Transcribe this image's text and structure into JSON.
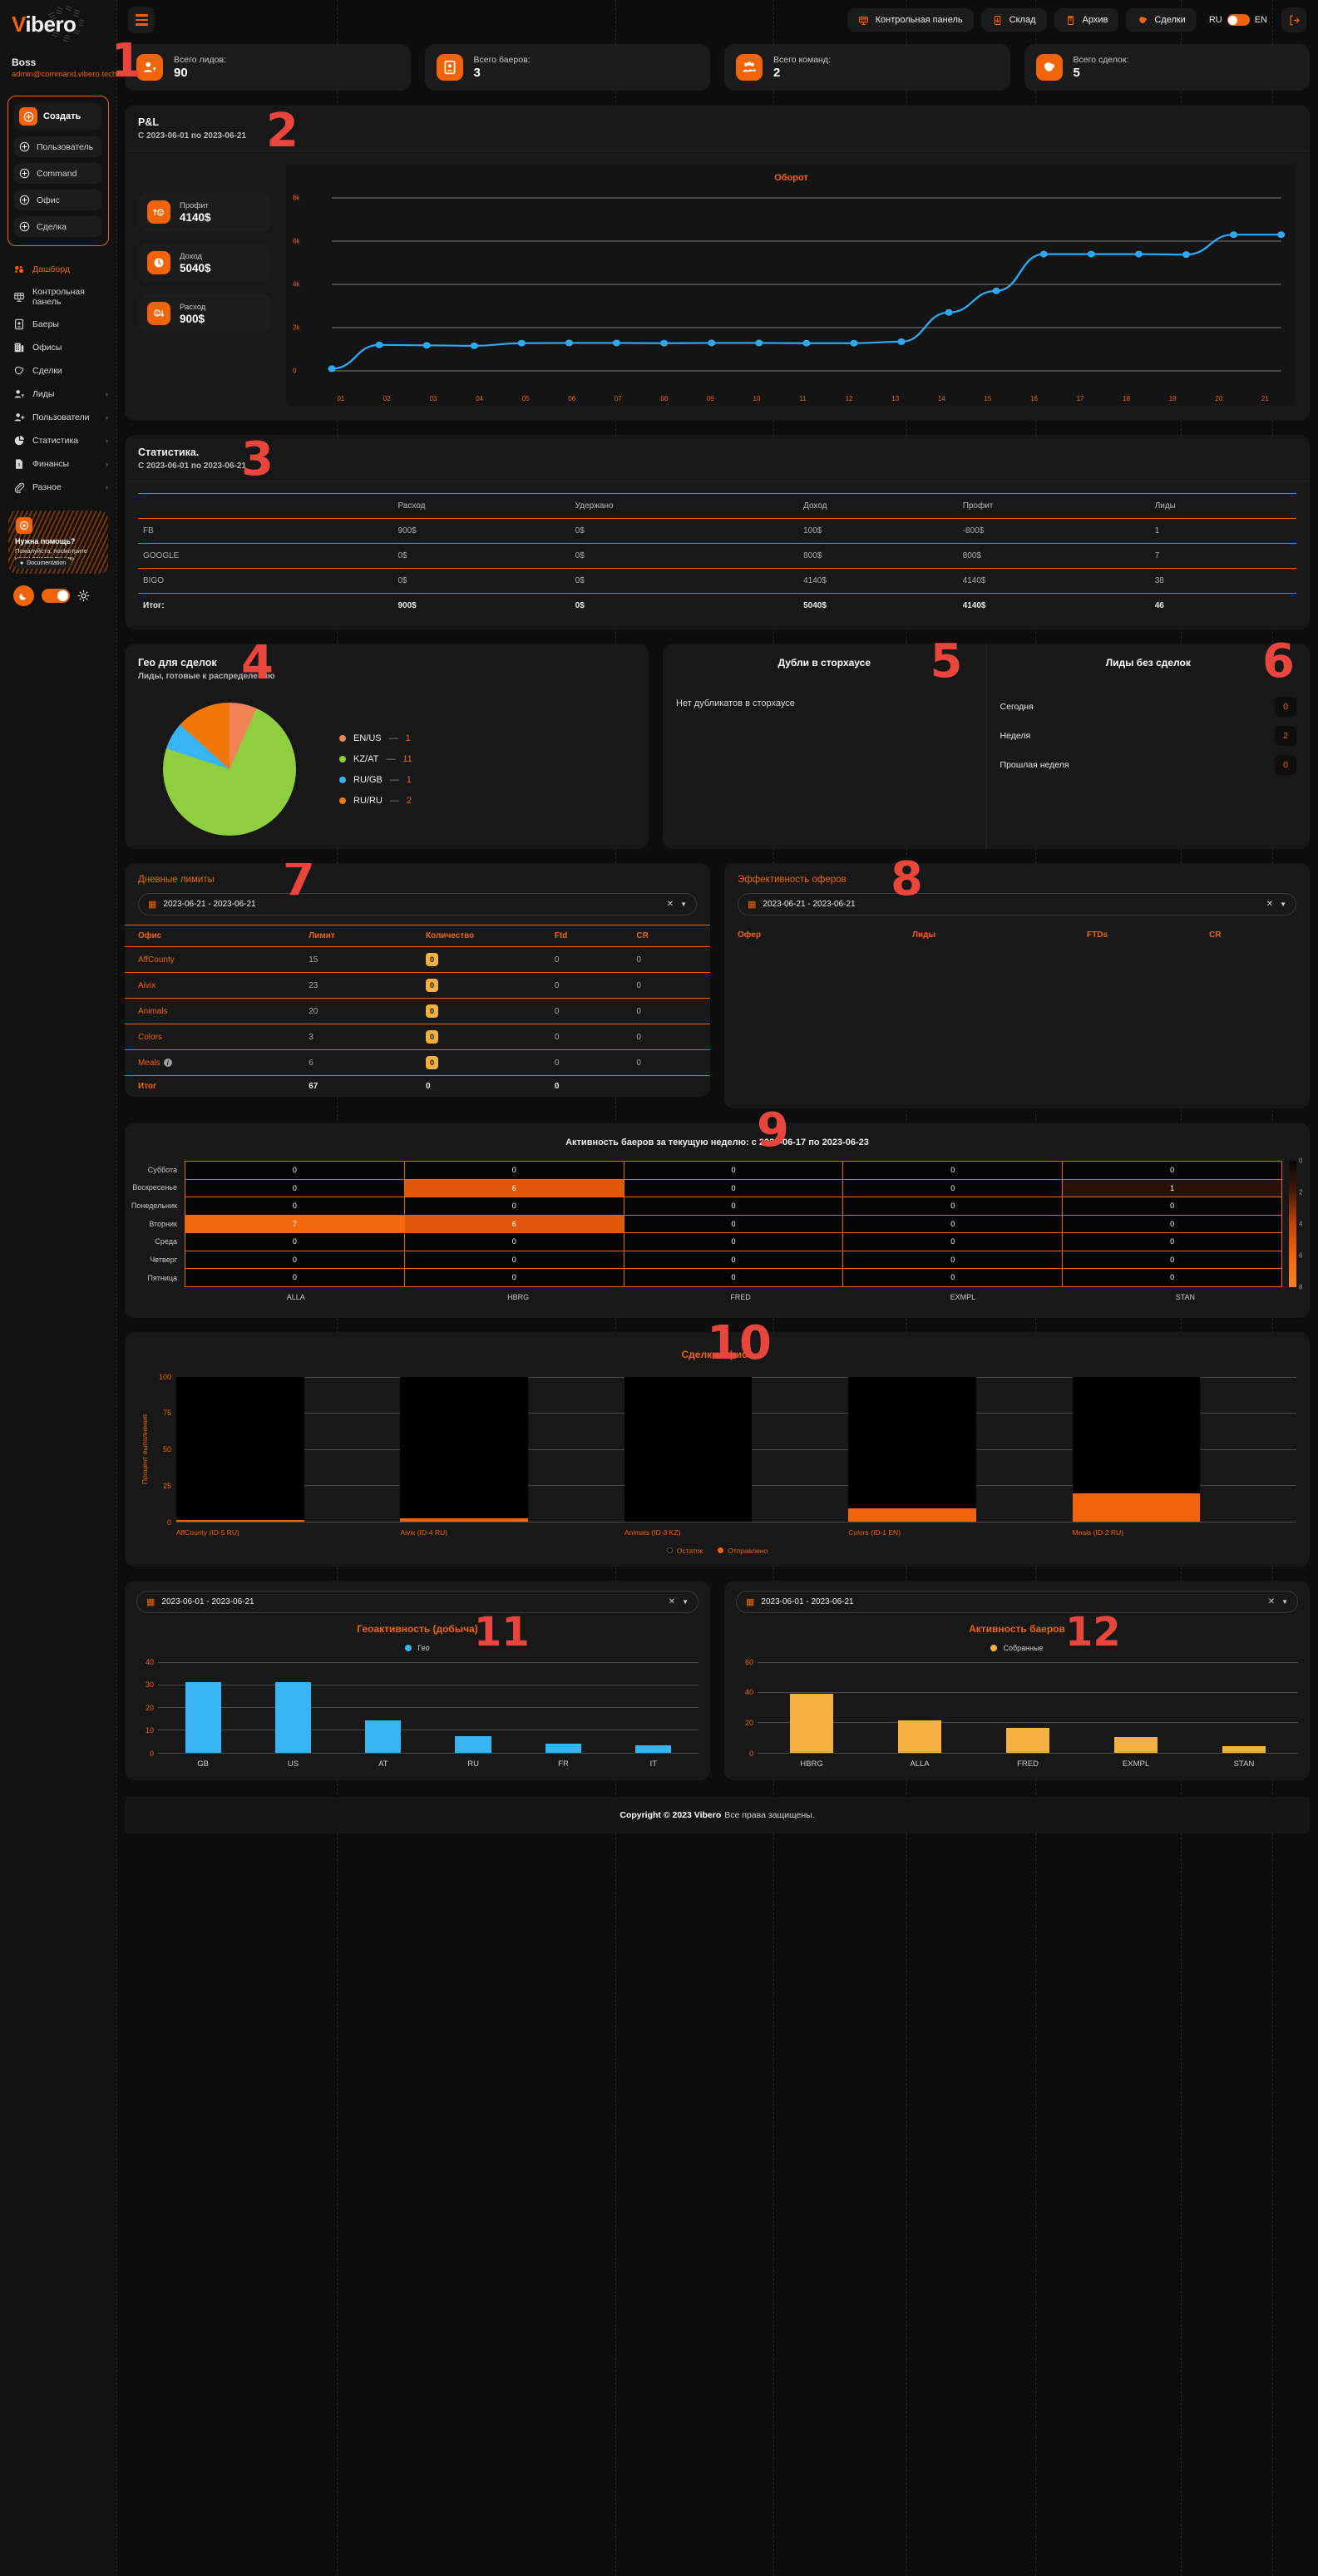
{
  "brand": {
    "name_v": "V",
    "name_rest": "ibero",
    "accent": "#f2640a"
  },
  "user": {
    "name": "Boss",
    "email": "admin@command.vibero.tech"
  },
  "sidebar": {
    "create": {
      "main_label": "Создать",
      "items": [
        {
          "label": "Пользователь",
          "icon": "plus-circle-icon"
        },
        {
          "label": "Command",
          "icon": "plus-circle-icon"
        },
        {
          "label": "Офис",
          "icon": "plus-circle-icon"
        },
        {
          "label": "Сделка",
          "icon": "plus-circle-icon"
        }
      ]
    },
    "nav": [
      {
        "label": "Дашборд",
        "icon": "dashboard-icon",
        "active": true,
        "chevron": ""
      },
      {
        "label": "Контрольная панель",
        "icon": "control-panel-icon",
        "active": false,
        "chevron": ""
      },
      {
        "label": "Баеры",
        "icon": "buyers-icon",
        "active": false,
        "chevron": ""
      },
      {
        "label": "Офисы",
        "icon": "offices-icon",
        "active": false,
        "chevron": ""
      },
      {
        "label": "Сделки",
        "icon": "deals-icon",
        "active": false,
        "chevron": ""
      },
      {
        "label": "Лиды",
        "icon": "leads-icon",
        "active": false,
        "chevron": "›"
      },
      {
        "label": "Пользователи",
        "icon": "users-icon",
        "active": false,
        "chevron": "›"
      },
      {
        "label": "Статистика",
        "icon": "statistics-icon",
        "active": false,
        "chevron": "›"
      },
      {
        "label": "Финансы",
        "icon": "finance-icon",
        "active": false,
        "chevron": "›"
      },
      {
        "label": "Разное",
        "icon": "misc-icon",
        "active": false,
        "chevron": "›"
      }
    ],
    "help": {
      "title": "Нужна помощь?",
      "text": "Пожалуйста, посмотрите нашу документацию",
      "button": "Documentation"
    }
  },
  "topbar": {
    "menu_icon": "hamburger-icon",
    "pills": [
      {
        "label": "Контрольная панель",
        "icon": "control-panel-icon"
      },
      {
        "label": "Склад",
        "icon": "storage-icon"
      },
      {
        "label": "Архив",
        "icon": "archive-icon"
      },
      {
        "label": "Сделки",
        "icon": "deals-icon"
      }
    ],
    "lang_left": "RU",
    "lang_right": "EN",
    "logout_icon": "logout-icon"
  },
  "stats": [
    {
      "label": "Всего лидов:",
      "value": "90",
      "icon": "leads-icon"
    },
    {
      "label": "Всего баеров:",
      "value": "3",
      "icon": "buyers-icon"
    },
    {
      "label": "Всего команд:",
      "value": "2",
      "icon": "teams-icon"
    },
    {
      "label": "Всего сделок:",
      "value": "5",
      "icon": "deals-icon"
    }
  ],
  "markers": {
    "m1": "1",
    "m2": "2",
    "m3": "3",
    "m4": "4",
    "m5": "5",
    "m6": "6",
    "m7": "7",
    "m8": "8",
    "m9": "9",
    "m10": "10",
    "m11": "11",
    "m12": "12"
  },
  "pl": {
    "title": "P&L",
    "subtitle": "С 2023-06-01 по 2023-06-21",
    "items": [
      {
        "label": "Профит",
        "value": "4140$",
        "icon": "profit-icon"
      },
      {
        "label": "Доход",
        "value": "5040$",
        "icon": "income-icon"
      },
      {
        "label": "Расход",
        "value": "900$",
        "icon": "expense-icon"
      }
    ]
  },
  "statistics": {
    "title": "Статистика.",
    "subtitle": "С 2023-06-01 по 2023-06-21",
    "columns": [
      "",
      "Расход",
      "Удержано",
      "Доход",
      "Профит",
      "Лиды"
    ],
    "rows": [
      [
        "FB",
        "900$",
        "0$",
        "100$",
        "-800$",
        "1"
      ],
      [
        "GOOGLE",
        "0$",
        "0$",
        "800$",
        "800$",
        "7"
      ],
      [
        "BIGO",
        "0$",
        "0$",
        "4140$",
        "4140$",
        "38"
      ],
      [
        "Итог:",
        "900$",
        "0$",
        "5040$",
        "4140$",
        "46"
      ]
    ]
  },
  "geo": {
    "title": "Гео для сделок",
    "subtitle": "Лиды, готовые к распределению",
    "legend": [
      {
        "label": "EN/US",
        "value": "1",
        "color": "#ef8354"
      },
      {
        "label": "KZ/AT",
        "value": "11",
        "color": "#8ece3f"
      },
      {
        "label": "RU/GB",
        "value": "1",
        "color": "#39b4f2"
      },
      {
        "label": "RU/RU",
        "value": "2",
        "color": "#f2770a"
      }
    ]
  },
  "duplicates": {
    "title": "Дубли в сторхаусе",
    "empty": "Нет дубликатов в сторхаусе"
  },
  "leads_nodeal": {
    "title": "Лиды без сделок",
    "rows": [
      {
        "label": "Сегодня",
        "value": "0"
      },
      {
        "label": "Неделя",
        "value": "2"
      },
      {
        "label": "Прошлая неделя",
        "value": "0"
      }
    ]
  },
  "limits": {
    "title": "Дневные лимиты",
    "date_range": "2023-06-21 - 2023-06-21",
    "columns": [
      "Офис",
      "Лимит",
      "Количество",
      "Ftd",
      "CR"
    ],
    "rows": [
      {
        "office": "AffCounty",
        "limit": "15",
        "qty": "0",
        "ftd": "0",
        "cr": "0",
        "info": false
      },
      {
        "office": "Aivix",
        "limit": "23",
        "qty": "0",
        "ftd": "0",
        "cr": "0",
        "info": false
      },
      {
        "office": "Animals",
        "limit": "20",
        "qty": "0",
        "ftd": "0",
        "cr": "0",
        "info": false
      },
      {
        "office": "Colors",
        "limit": "3",
        "qty": "0",
        "ftd": "0",
        "cr": "0",
        "info": false
      },
      {
        "office": "Meals",
        "limit": "6",
        "qty": "0",
        "ftd": "0",
        "cr": "0",
        "info": true
      }
    ],
    "total": {
      "label": "Итог",
      "limit": "67",
      "qty": "0",
      "ftd": "0",
      "cr": ""
    }
  },
  "offers": {
    "title": "Эффективность оферов",
    "date_range": "2023-06-21 - 2023-06-21",
    "columns": [
      "Офер",
      "Лиды",
      "FTDs",
      "CR"
    ],
    "rows": []
  },
  "footer": {
    "bold": "Copyright © 2023 Vibero",
    "text": "Все права защищены."
  },
  "chart_data": [
    {
      "id": "oborot",
      "type": "line",
      "title": "Оборот",
      "xlabel": "",
      "ylabel": "",
      "x": [
        "01",
        "02",
        "03",
        "04",
        "05",
        "06",
        "07",
        "08",
        "09",
        "10",
        "11",
        "12",
        "13",
        "14",
        "15",
        "16",
        "17",
        "18",
        "19",
        "20",
        "21"
      ],
      "values": [
        100,
        1200,
        1180,
        1160,
        1280,
        1290,
        1290,
        1280,
        1290,
        1290,
        1280,
        1280,
        1350,
        2700,
        3700,
        5400,
        5400,
        5400,
        5380,
        6300,
        6300
      ],
      "ylim": [
        0,
        8000
      ],
      "yticks": [
        "0",
        "2k",
        "4k",
        "6k",
        "8k"
      ],
      "grid": true,
      "line_color": "#2ea8f0",
      "legend": ""
    },
    {
      "id": "geo-pie",
      "type": "pie",
      "title": "Гео для сделок",
      "labels": [
        "EN/US",
        "KZ/AT",
        "RU/GB",
        "RU/RU"
      ],
      "values": [
        1,
        11,
        1,
        2
      ],
      "colors": [
        "#ef8354",
        "#8ece3f",
        "#39b4f2",
        "#f2770a"
      ],
      "legend": "right"
    },
    {
      "id": "buyer-activity-heatmap",
      "type": "heatmap",
      "title": "Активность баеров за текущую неделю: с 2023-06-17 по 2023-06-23",
      "x": [
        "ALLA",
        "HBRG",
        "FRED",
        "EXMPL",
        "STAN"
      ],
      "y": [
        "Суббота",
        "Воскресенье",
        "Понедельник",
        "Вторник",
        "Среда",
        "Четверг",
        "Пятница"
      ],
      "values": [
        [
          0,
          0,
          0,
          0,
          0
        ],
        [
          0,
          6,
          0,
          0,
          1
        ],
        [
          0,
          0,
          0,
          0,
          0
        ],
        [
          7,
          6,
          0,
          0,
          0
        ],
        [
          0,
          0,
          0,
          0,
          0
        ],
        [
          0,
          0,
          0,
          0,
          0
        ],
        [
          0,
          0,
          0,
          0,
          0
        ]
      ],
      "colorbar_ticks": [
        "0",
        "2",
        "4",
        "6",
        "8"
      ],
      "zmin": 0,
      "zmax": 8
    },
    {
      "id": "office-deals",
      "type": "bar",
      "title": "Сделки офиса",
      "ylabel": "Процент выполнения",
      "categories": [
        "AffCounty (ID-5 RU)",
        "Aivix (ID-4 RU)",
        "Animals (ID-3 KZ)",
        "Colors (ID-1 EN)",
        "Meals (ID-2 RU)"
      ],
      "series": [
        {
          "name": "Остаток",
          "color": "#000000",
          "values": [
            99,
            98,
            100,
            91,
            81
          ]
        },
        {
          "name": "Отправлено",
          "color": "#f2640a",
          "values": [
            1,
            2,
            0,
            9,
            19
          ]
        }
      ],
      "ylim": [
        0,
        100
      ],
      "yticks": [
        "0",
        "25",
        "50",
        "75",
        "100"
      ],
      "stacked": true
    },
    {
      "id": "geo-activity",
      "type": "bar",
      "title": "Геоактивность (добыча)",
      "date_range": "2023-06-01 - 2023-06-21",
      "legend_label": "Гео",
      "legend_color": "#39b4f2",
      "categories": [
        "GB",
        "US",
        "AT",
        "RU",
        "FR",
        "IT"
      ],
      "values": [
        31,
        31,
        14,
        7,
        4,
        3
      ],
      "ylim": [
        0,
        40
      ],
      "yticks": [
        "0",
        "10",
        "20",
        "30",
        "40"
      ],
      "bar_color": "#39b4f2"
    },
    {
      "id": "buyer-activity-bar",
      "type": "bar",
      "title": "Активность баеров",
      "date_range": "2023-06-01 - 2023-06-21",
      "legend_label": "Собранные",
      "legend_color": "#f5b042",
      "categories": [
        "HBRG",
        "ALLA",
        "FRED",
        "EXMPL",
        "STAN"
      ],
      "values": [
        39,
        21,
        16,
        10,
        4
      ],
      "ylim": [
        0,
        60
      ],
      "yticks": [
        "0",
        "20",
        "40",
        "60"
      ],
      "bar_color": "#f5b042"
    }
  ]
}
